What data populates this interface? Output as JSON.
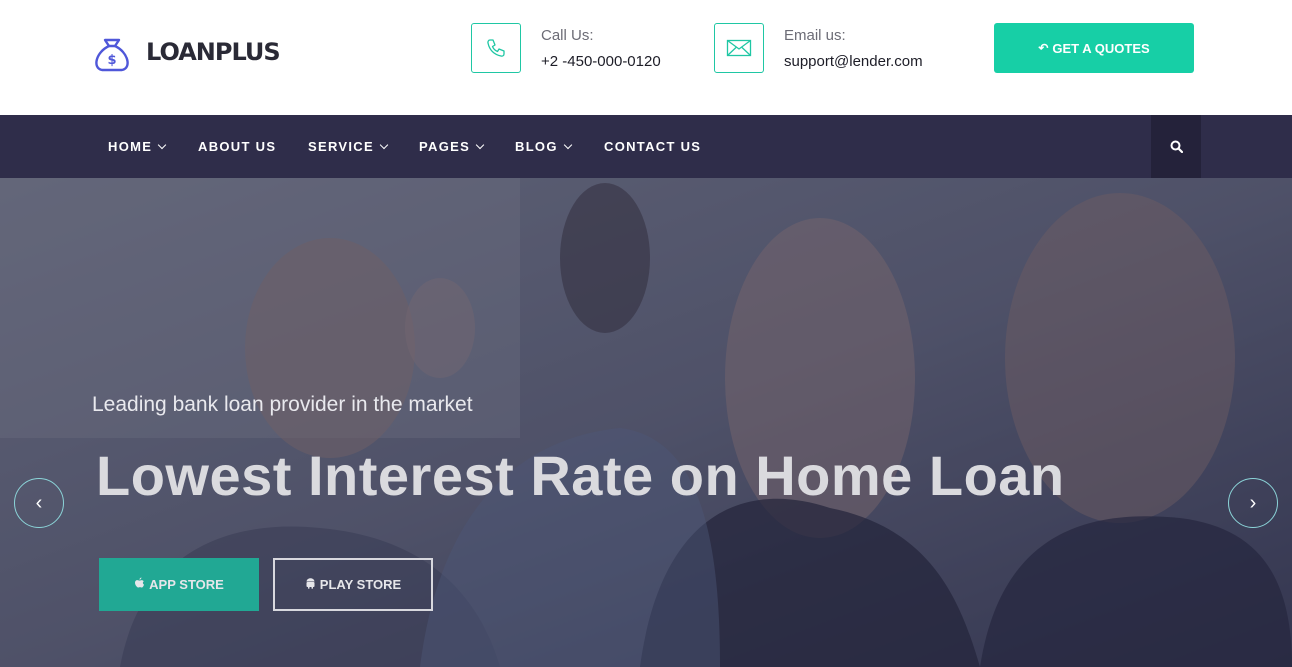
{
  "brand": {
    "name": "LOANPLUS",
    "icon": "money-bag-icon",
    "icon_color": "#4f57d9"
  },
  "header": {
    "call": {
      "label": "Call Us:",
      "value": "+2 -450-000-0120",
      "icon": "phone-icon"
    },
    "email": {
      "label": "Email us:",
      "value": "support@lender.com",
      "icon": "envelope-icon"
    },
    "quote_button": {
      "label": "GET A QUOTES",
      "icon": "reply-icon"
    }
  },
  "nav": {
    "items": [
      {
        "label": "HOME",
        "dropdown": true
      },
      {
        "label": "ABOUT US",
        "dropdown": false
      },
      {
        "label": "SERVICE",
        "dropdown": true
      },
      {
        "label": "PAGES",
        "dropdown": true
      },
      {
        "label": "BLOG",
        "dropdown": true
      },
      {
        "label": "CONTACT US",
        "dropdown": false
      }
    ],
    "search_icon": "search-icon"
  },
  "hero": {
    "subtitle": "Leading bank loan provider in the market",
    "title": "Lowest Interest Rate on Home Loan",
    "app_store": {
      "label": "APP STORE",
      "icon": "apple-icon"
    },
    "play_store": {
      "label": "PLAY STORE",
      "icon": "android-icon"
    },
    "prev": "‹",
    "next": "›"
  },
  "colors": {
    "accent": "#17cfa6",
    "nav_bg": "#2f2d4a",
    "nav_search_bg": "#24223a",
    "brand_icon": "#4f57d9"
  }
}
